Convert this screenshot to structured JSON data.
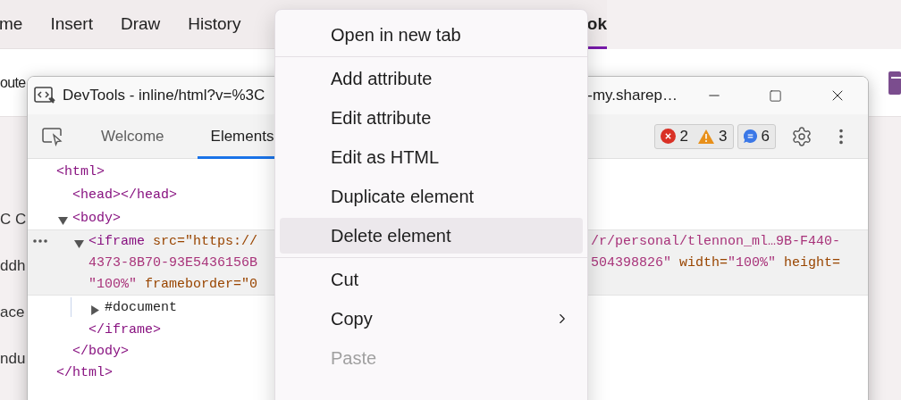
{
  "app_tabs": [
    {
      "label": "me",
      "selected": false
    },
    {
      "label": "Insert",
      "selected": false
    },
    {
      "label": "Draw",
      "selected": false
    },
    {
      "label": "History",
      "selected": false
    },
    {
      "label": "ok",
      "selected": true
    }
  ],
  "ribbon": {
    "label": "oute"
  },
  "sidebar": {
    "items": [
      "C C",
      "ddh",
      "ace",
      "ndu"
    ]
  },
  "devtools": {
    "title_start": "DevTools - inline/html?v=%3C",
    "title_end": "-my.sharep…",
    "tabs": [
      {
        "label": "Welcome",
        "selected": false
      },
      {
        "label": "Elements",
        "selected": true
      }
    ],
    "issues": {
      "errors": "2",
      "warnings": "3",
      "messages": "6"
    },
    "tree": [
      {
        "selected": false,
        "lines": [
          {
            "left": [
              {
                "kind": "tag",
                "text": "<html>"
              }
            ]
          }
        ],
        "closing": [
          {
            "kind": "tag",
            "text": "</html>"
          }
        ],
        "children": [
          {
            "selected": false,
            "lines": [
              {
                "left": [
                  {
                    "kind": "tag",
                    "text": "<head></head>"
                  }
                ]
              }
            ]
          },
          {
            "selected": false,
            "expanded": true,
            "lines": [
              {
                "left": [
                  {
                    "kind": "tag",
                    "text": "<body>"
                  }
                ]
              }
            ],
            "closing": [
              {
                "kind": "tag",
                "text": "</body>"
              }
            ],
            "children": [
              {
                "selected": true,
                "expanded": true,
                "lines": [
                  {
                    "left": [
                      {
                        "kind": "tag",
                        "text": "<iframe"
                      },
                      {
                        "kind": "attr",
                        "text": " src=\"https://"
                      }
                    ],
                    "right": [
                      {
                        "kind": "value",
                        "text": "/r/personal/tlennon_ml…9B-F440-"
                      }
                    ]
                  },
                  {
                    "left": [
                      {
                        "kind": "value",
                        "text": "4373-8B70-93E5436156B"
                      }
                    ],
                    "right": [
                      {
                        "kind": "value",
                        "text": "504398826\""
                      },
                      {
                        "kind": "attr",
                        "text": " width="
                      },
                      {
                        "kind": "value",
                        "text": "\"100%\""
                      },
                      {
                        "kind": "attr",
                        "text": " height="
                      }
                    ]
                  },
                  {
                    "left": [
                      {
                        "kind": "value",
                        "text": "\"100%\""
                      },
                      {
                        "kind": "attr",
                        "text": " frameborder=\"0"
                      }
                    ]
                  }
                ],
                "closing": [
                  {
                    "kind": "tag",
                    "text": "</iframe>"
                  }
                ],
                "children": [
                  {
                    "selected": false,
                    "expanded": false,
                    "lines": [
                      {
                        "left": [
                          {
                            "kind": "text",
                            "text": "#document"
                          }
                        ]
                      }
                    ]
                  }
                ]
              }
            ]
          }
        ]
      }
    ]
  },
  "context_menu": {
    "items": [
      {
        "kind": "item",
        "label": "Open in new tab",
        "selected": false,
        "disabled": false,
        "submenu": false
      },
      {
        "kind": "separator"
      },
      {
        "kind": "item",
        "label": "Add attribute",
        "selected": false,
        "disabled": false,
        "submenu": false
      },
      {
        "kind": "item",
        "label": "Edit attribute",
        "selected": false,
        "disabled": false,
        "submenu": false
      },
      {
        "kind": "item",
        "label": "Edit as HTML",
        "selected": false,
        "disabled": false,
        "submenu": false
      },
      {
        "kind": "item",
        "label": "Duplicate element",
        "selected": false,
        "disabled": false,
        "submenu": false
      },
      {
        "kind": "item",
        "label": "Delete element",
        "selected": true,
        "disabled": false,
        "submenu": false
      },
      {
        "kind": "separator"
      },
      {
        "kind": "item",
        "label": "Cut",
        "selected": false,
        "disabled": false,
        "submenu": false
      },
      {
        "kind": "item",
        "label": "Copy",
        "selected": false,
        "disabled": false,
        "submenu": true
      },
      {
        "kind": "item",
        "label": "Paste",
        "selected": false,
        "disabled": true,
        "submenu": false
      }
    ]
  }
}
